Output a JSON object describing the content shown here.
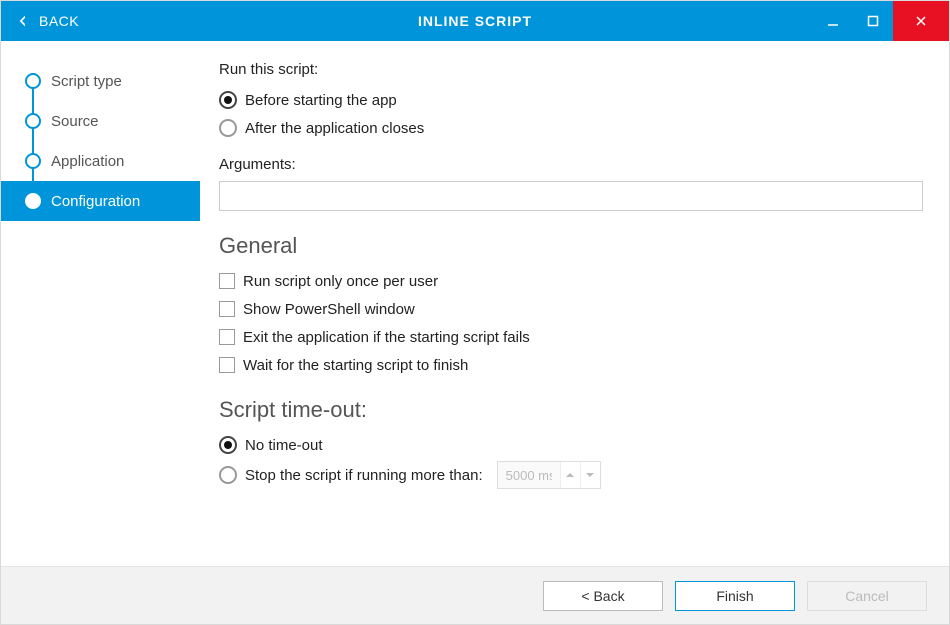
{
  "titlebar": {
    "back_label": "BACK",
    "title": "INLINE SCRIPT"
  },
  "sidebar": {
    "steps": [
      {
        "label": "Script type"
      },
      {
        "label": "Source"
      },
      {
        "label": "Application"
      },
      {
        "label": "Configuration"
      }
    ],
    "active_index": 3
  },
  "content": {
    "run_label": "Run this script:",
    "run_options": {
      "before": "Before starting the app",
      "after": "After the application closes"
    },
    "arguments_label": "Arguments:",
    "arguments_value": "",
    "general_heading": "General",
    "general_checks": {
      "once": "Run script only once per user",
      "show_ps": "Show PowerShell window",
      "exit_fail": "Exit the application if the starting script fails",
      "wait": "Wait for the starting script to finish"
    },
    "timeout_heading": "Script time-out:",
    "timeout_options": {
      "none": "No time-out",
      "stop": "Stop the script if running more than:"
    },
    "timeout_value": "5000 ms"
  },
  "footer": {
    "back": "< Back",
    "finish": "Finish",
    "cancel": "Cancel"
  }
}
